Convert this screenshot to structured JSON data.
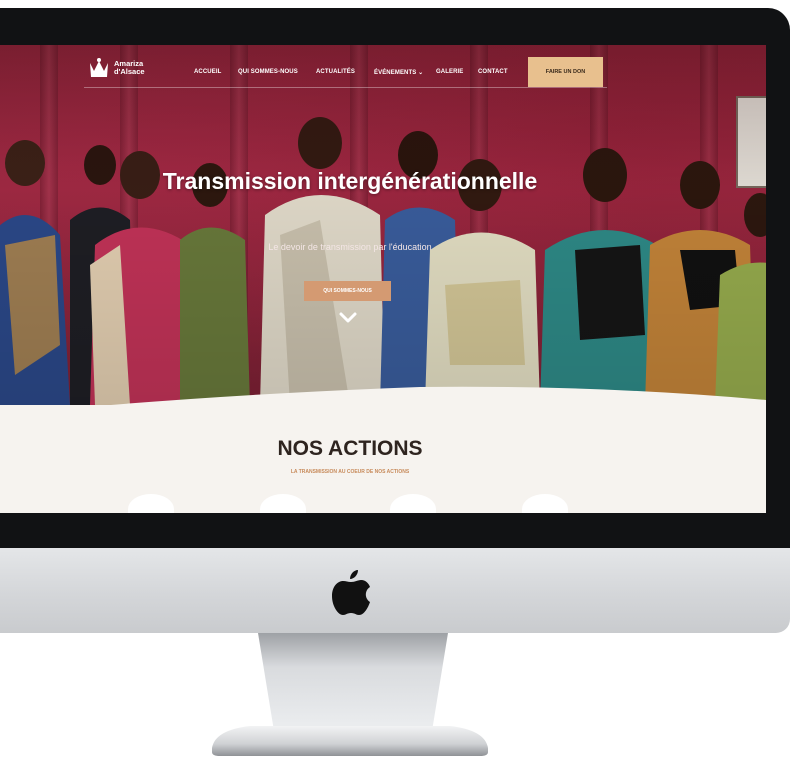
{
  "logo": {
    "text": "Amariza\nd'Alsace"
  },
  "nav": {
    "items": [
      {
        "label": "ACCUEIL"
      },
      {
        "label": "QUI SOMMES-NOUS"
      },
      {
        "label": "ACTUALITÉS"
      },
      {
        "label": "ÉVÉNEMENTS ⌄"
      },
      {
        "label": "GALERIE"
      },
      {
        "label": "CONTACT"
      }
    ],
    "donate_label": "FAIRE UN DON"
  },
  "hero": {
    "title": "Transmission intergénérationnelle",
    "subtitle": "Le devoir de transmission par l'éducation",
    "button_label": "QUI SOMMES-NOUS"
  },
  "actions": {
    "title": "NOS ACTIONS",
    "subtitle": "LA TRANSMISSION AU COEUR DE NOS ACTIONS"
  },
  "icons": [
    "apple-logo-icon",
    "chevron-down-icon",
    "logo-crown-icon"
  ],
  "colors": {
    "accent": "#e8c08e",
    "button": "#d49a72",
    "hero_bg": "#8e2438",
    "section_bg": "#f6f3ef",
    "title_dark": "#2e241f"
  }
}
